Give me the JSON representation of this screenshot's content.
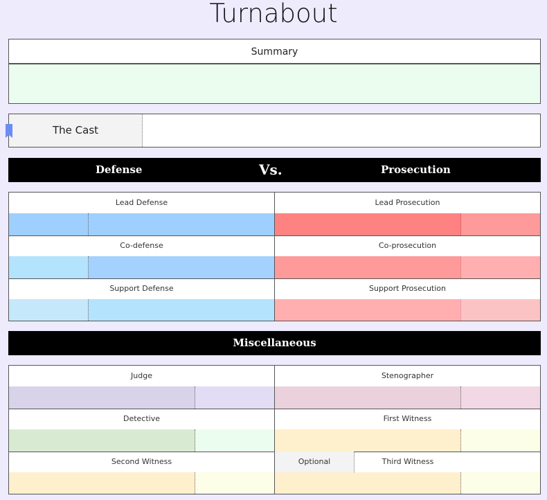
{
  "page": {
    "title": "Turnabout"
  },
  "summary": {
    "label": "Summary",
    "value": ""
  },
  "cast": {
    "label": "The Cast",
    "value": ""
  },
  "versus": {
    "defense": "Defense",
    "vs": "Vs.",
    "prosecution": "Prosecution"
  },
  "roles": {
    "lead_defense": "Lead Defense",
    "lead_prosecution": "Lead Prosecution",
    "co_defense": "Co-defense",
    "co_prosecution": "Co-prosecution",
    "support_defense": "Support Defense",
    "support_prosecution": "Support Prosecution"
  },
  "misc": {
    "title": "Miscellaneous",
    "judge": "Judge",
    "stenographer": "Stenographer",
    "detective": "Detective",
    "first_witness": "First Witness",
    "second_witness": "Second Witness",
    "optional": "Optional",
    "third_witness": "Third Witness"
  },
  "colors": {
    "background": "#eeebfd",
    "summary_fill": "#ebfdef",
    "defense": [
      "#9fcfff",
      "#a4d1fe",
      "#b4e3fd",
      "#c5e8fb"
    ],
    "prosecution": [
      "#ff8282",
      "#ff9a9a",
      "#ffafaf",
      "#fcc3c5"
    ],
    "judge": [
      "#d9d3ea",
      "#e2ddf5"
    ],
    "stenographer": [
      "#ead1dc",
      "#f2d8e4"
    ],
    "detective": [
      "#d9ead3",
      "#ebfdef"
    ],
    "witness": [
      "#fff0cd",
      "#fdfee8"
    ]
  }
}
